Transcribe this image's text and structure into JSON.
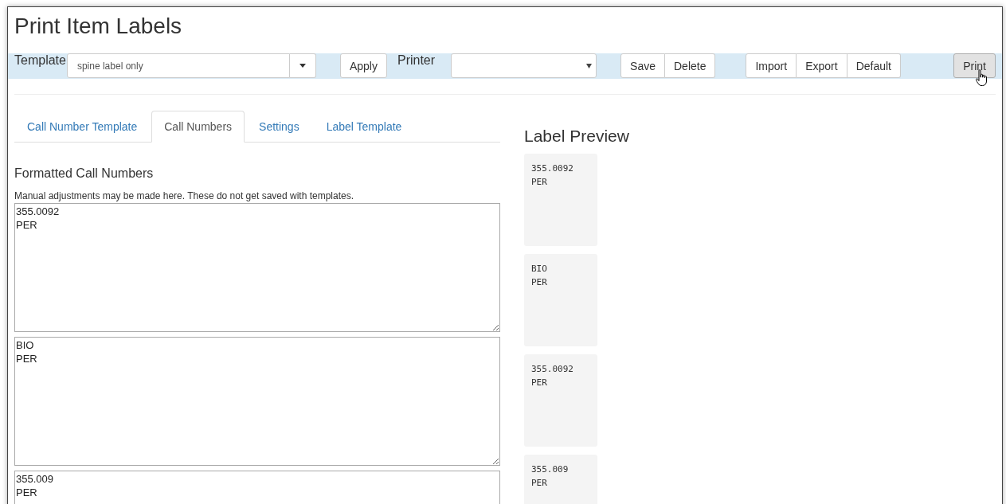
{
  "window": {
    "title": "Print Item Labels"
  },
  "toolbar": {
    "template_label": "Template",
    "template_value": "spine label only",
    "apply": "Apply",
    "printer_label": "Printer",
    "button_groups": [
      [
        "Save",
        "Delete"
      ],
      [
        "Import",
        "Export",
        "Default"
      ]
    ],
    "print": {
      "label": "Print",
      "pressed": true
    }
  },
  "tabs": [
    {
      "label": "Call Number Template",
      "selected": false
    },
    {
      "label": "Call Numbers",
      "selected": true
    },
    {
      "label": "Settings",
      "selected": false
    },
    {
      "label": "Label Template",
      "selected": false
    }
  ],
  "section": {
    "heading": "Formatted Call Numbers",
    "note": "Manual adjustments may be made here. These do not get saved with templates."
  },
  "call_numbers": [
    [
      "355.0092",
      "PER"
    ],
    [
      "BIO",
      "PER"
    ],
    [
      "355.009",
      "PER"
    ]
  ],
  "preview": {
    "heading": "Label Preview",
    "labels": [
      [
        "355.0092",
        "PER"
      ],
      [
        "BIO",
        "PER"
      ],
      [
        "355.0092",
        "PER"
      ],
      [
        "355.009",
        "PER"
      ]
    ]
  }
}
